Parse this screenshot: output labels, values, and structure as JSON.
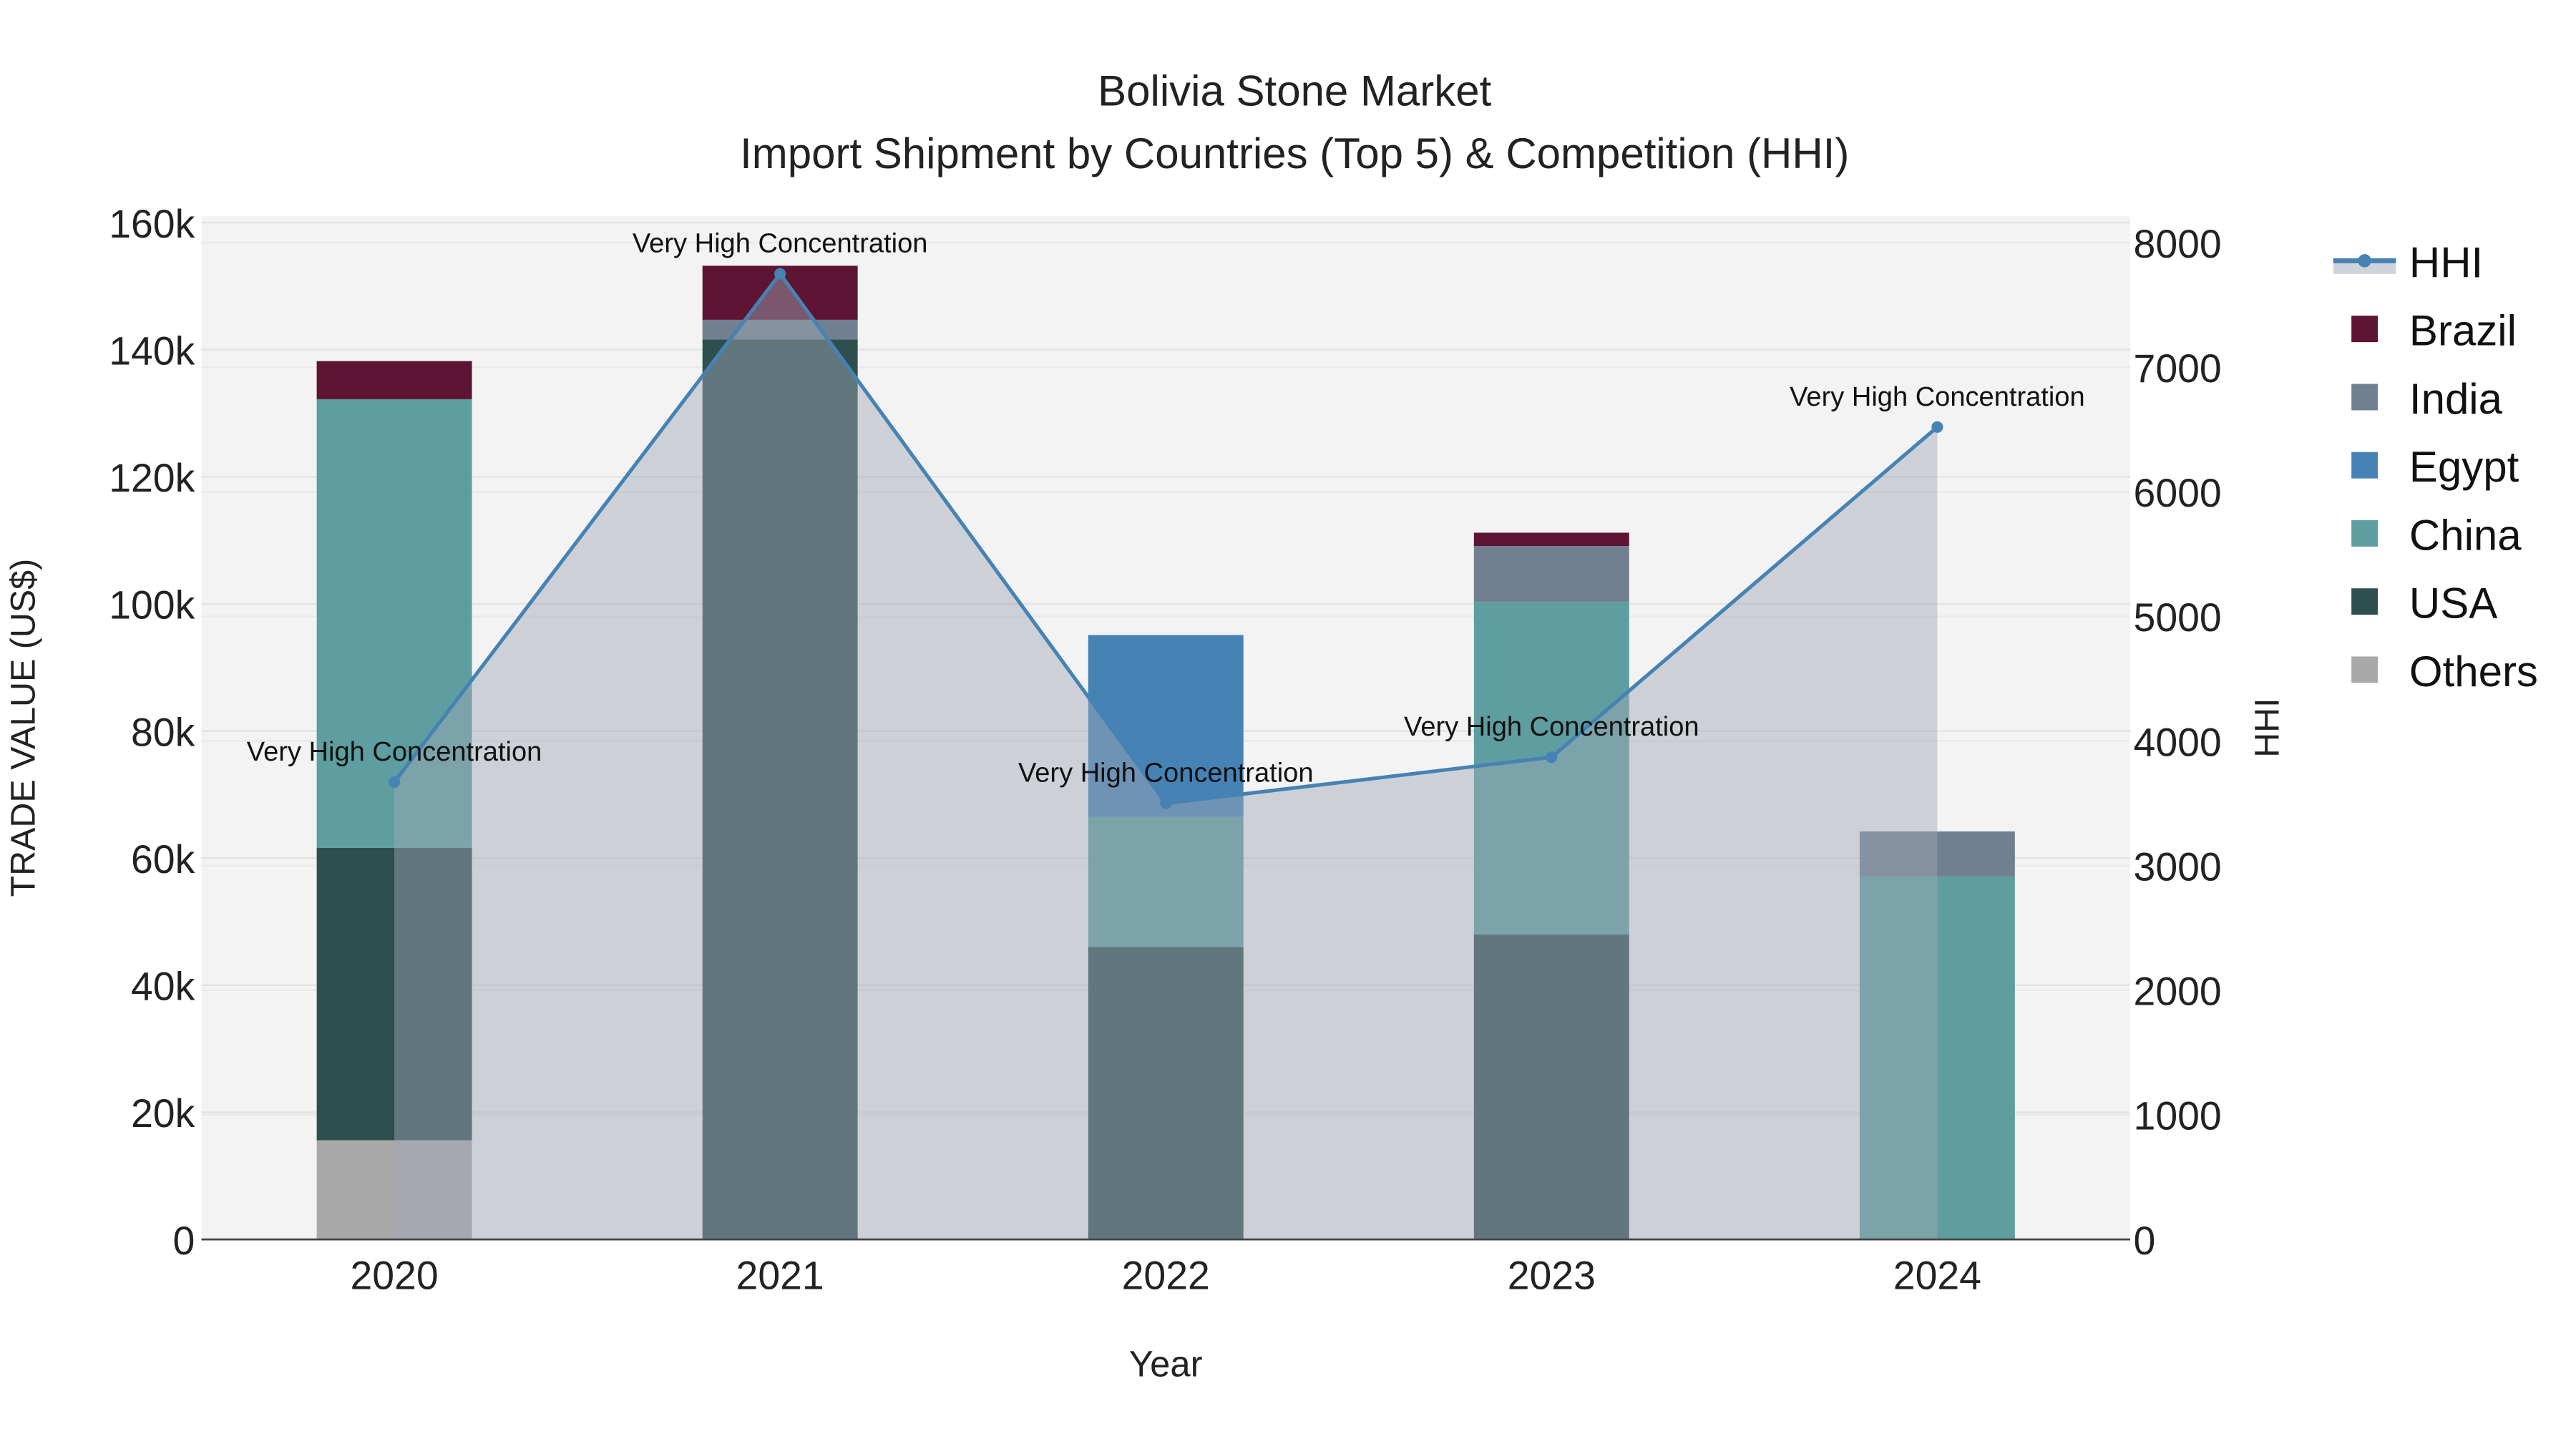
{
  "chart_data": {
    "type": "bar",
    "title": "Bolivia Stone Market",
    "subtitle": "Import Shipment by Countries (Top 5) & Competition (HHI)",
    "xlabel": "Year",
    "ylabel": "TRADE VALUE (US$)",
    "y2label": "HHI",
    "categories": [
      "2020",
      "2021",
      "2022",
      "2023",
      "2024"
    ],
    "ylim": [
      0,
      161000
    ],
    "y2lim": [
      0,
      8212
    ],
    "yticks": [
      0,
      20000,
      40000,
      60000,
      80000,
      100000,
      120000,
      140000,
      160000
    ],
    "yticklabels": [
      "0",
      "20k",
      "40k",
      "60k",
      "80k",
      "100k",
      "120k",
      "140k",
      "160k"
    ],
    "y2ticks": [
      0,
      1000,
      2000,
      3000,
      4000,
      5000,
      6000,
      7000,
      8000
    ],
    "y2ticklabels": [
      "0",
      "1000",
      "2000",
      "3000",
      "4000",
      "5000",
      "6000",
      "7000",
      "8000"
    ],
    "grid": true,
    "legend_placement": "right",
    "series": [
      {
        "name": "Others",
        "color": "#a9a9a9",
        "values": [
          15600,
          0,
          0,
          0,
          0
        ]
      },
      {
        "name": "USA",
        "color": "#2f4f4f",
        "values": [
          46000,
          141600,
          46000,
          48000,
          0
        ]
      },
      {
        "name": "China",
        "color": "#5f9ea0",
        "values": [
          70600,
          0,
          20500,
          52300,
          57100
        ]
      },
      {
        "name": "Egypt",
        "color": "#4682b4",
        "values": [
          0,
          0,
          28600,
          0,
          0
        ]
      },
      {
        "name": "India",
        "color": "#708090",
        "values": [
          0,
          3100,
          0,
          8800,
          7100
        ]
      },
      {
        "name": "Brazil",
        "color": "#5e1433",
        "values": [
          6000,
          8500,
          0,
          2100,
          0
        ]
      }
    ],
    "hhi": {
      "name": "HHI",
      "color": "#4682b4",
      "values": [
        3670,
        7750,
        3500,
        3870,
        6520
      ],
      "annotations": [
        "Very High Concentration",
        "Very High Concentration",
        "Very High Concentration",
        "Very High Concentration",
        "Very High Concentration"
      ]
    },
    "legend_order": [
      "HHI",
      "Brazil",
      "India",
      "Egypt",
      "China",
      "USA",
      "Others"
    ]
  }
}
